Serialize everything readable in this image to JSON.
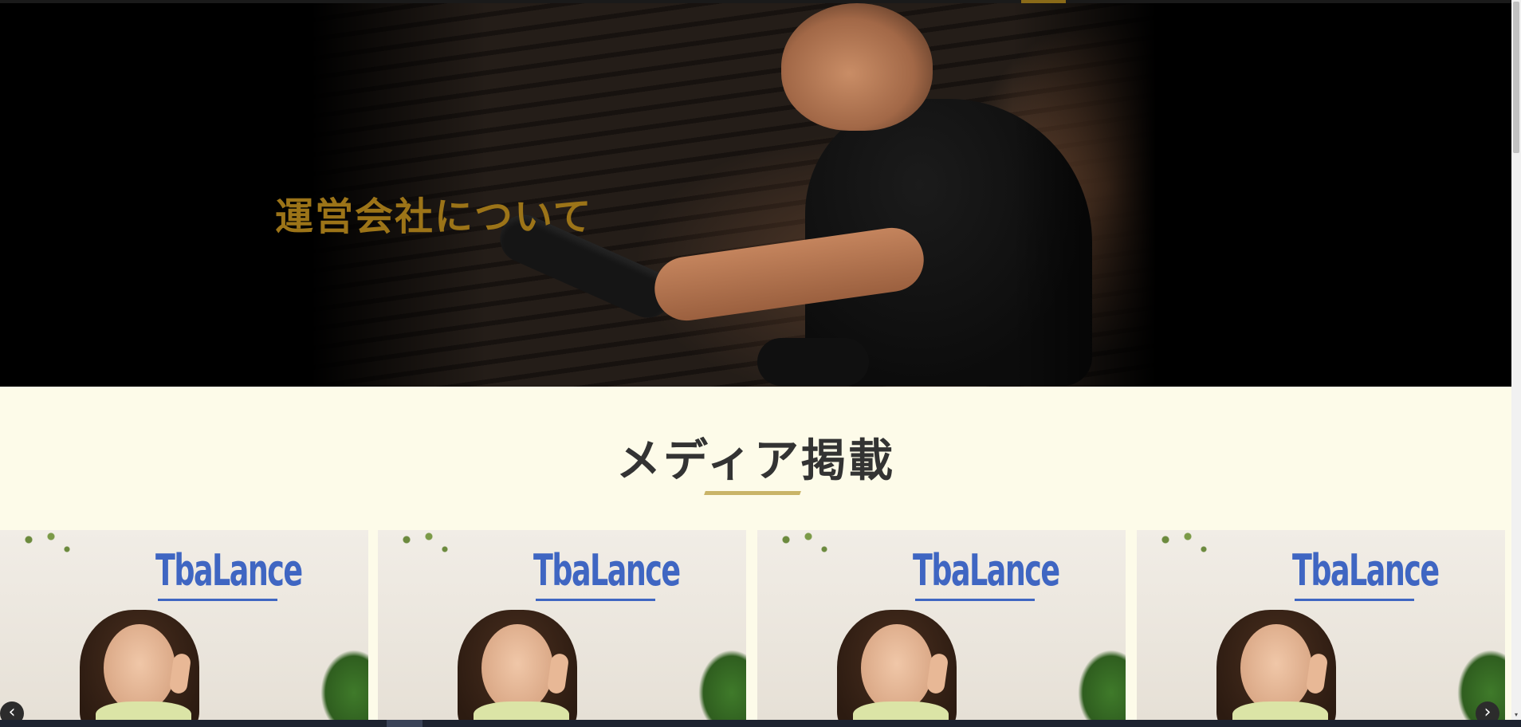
{
  "hero": {
    "title": "運営会社について"
  },
  "media": {
    "heading": "メディア掲載",
    "slides": [
      {
        "logo_text": "TbaLance"
      },
      {
        "logo_text": "TbaLance"
      },
      {
        "logo_text": "TbaLance"
      },
      {
        "logo_text": "TbaLance"
      }
    ],
    "prev_arrow": "‹",
    "next_arrow": "›"
  },
  "colors": {
    "hero_title": "#9c7418",
    "media_bg": "#fdfbe9",
    "underline": "#c9b468",
    "logo_blue": "#3f66c2"
  }
}
